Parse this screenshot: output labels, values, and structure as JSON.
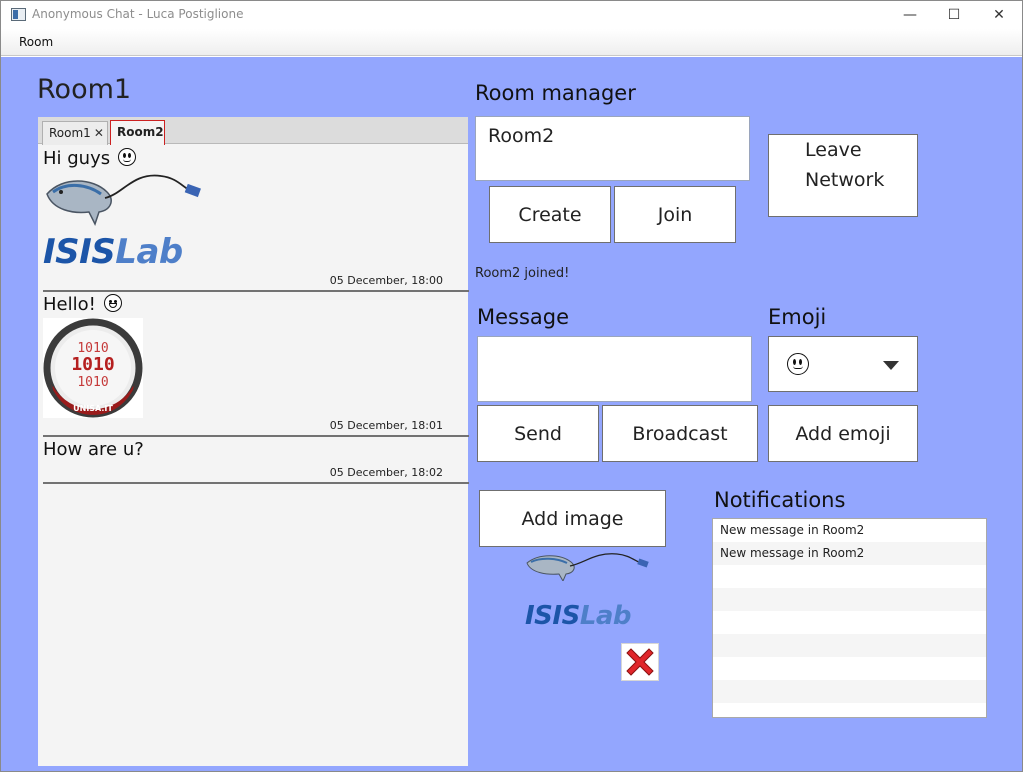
{
  "window": {
    "title": "Anonymous Chat - Luca Postiglione",
    "minimize_glyph": "—",
    "maximize_glyph": "☐",
    "close_glyph": "✕"
  },
  "menubar": {
    "items": [
      {
        "label": "Room"
      }
    ]
  },
  "current_room": "Room1",
  "tabs": [
    {
      "label": "Room1",
      "closable": true,
      "close_glyph": "✕"
    },
    {
      "label": "Room2",
      "selected": true
    }
  ],
  "messages": [
    {
      "text": "Hi guys",
      "emoji": "slightly-smiling-face",
      "image": "isislab-logo",
      "time": "05 December, 18:00"
    },
    {
      "text": "Hello!",
      "emoji": "grinning-face",
      "image": "unisa-dipartimento-informatica-logo",
      "time": "05 December, 18:01"
    },
    {
      "text": "How are u?",
      "time": "05 December, 18:02"
    }
  ],
  "room_manager": {
    "label": "Room manager",
    "input_value": "Room2",
    "create_label": "Create",
    "join_label": "Join",
    "leave_label_line1": "Leave",
    "leave_label_line2": "Network",
    "status": "Room2 joined!"
  },
  "message_section": {
    "label": "Message",
    "input_value": "",
    "send_label": "Send",
    "broadcast_label": "Broadcast"
  },
  "emoji_section": {
    "label": "Emoji",
    "selected_emoji": "slightly-smiling-face",
    "add_label": "Add emoji"
  },
  "image_section": {
    "add_label": "Add image",
    "preview_image": "isislab-logo",
    "remove_icon": "red-x-icon"
  },
  "notifications": {
    "label": "Notifications",
    "items": [
      "New message in Room2",
      "New message in Room2"
    ]
  },
  "logo_text": {
    "isis": "ISIS",
    "lab": "Lab",
    "unisa": "UNISA.IT",
    "binary": "1010"
  },
  "colors": {
    "background": "#93a6fe",
    "panel": "#f4f4f4",
    "accent_logo": "#1c55a8",
    "unisa_red": "#9a1b1b"
  }
}
